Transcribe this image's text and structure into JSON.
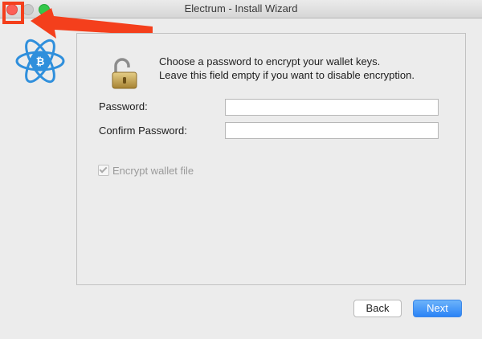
{
  "window": {
    "title": "Electrum  -  Install Wizard"
  },
  "wizard": {
    "message_line1": "Choose a password to encrypt your wallet keys.",
    "message_line2": "Leave this field empty if you want to disable encryption.",
    "password_label": "Password:",
    "password_value": "",
    "confirm_label": "Confirm Password:",
    "confirm_value": "",
    "encrypt_label": "Encrypt wallet file",
    "encrypt_checked": true,
    "encrypt_enabled": false
  },
  "buttons": {
    "back_label": "Back",
    "next_label": "Next"
  },
  "colors": {
    "accent": "#2b83f6",
    "annotation": "#f43f1c",
    "logo": "#2f8fdc",
    "close": "#fc5f57",
    "zoom": "#34c84a"
  },
  "icons": {
    "logo": "electrum-logo-icon",
    "lock": "open-padlock-icon"
  }
}
